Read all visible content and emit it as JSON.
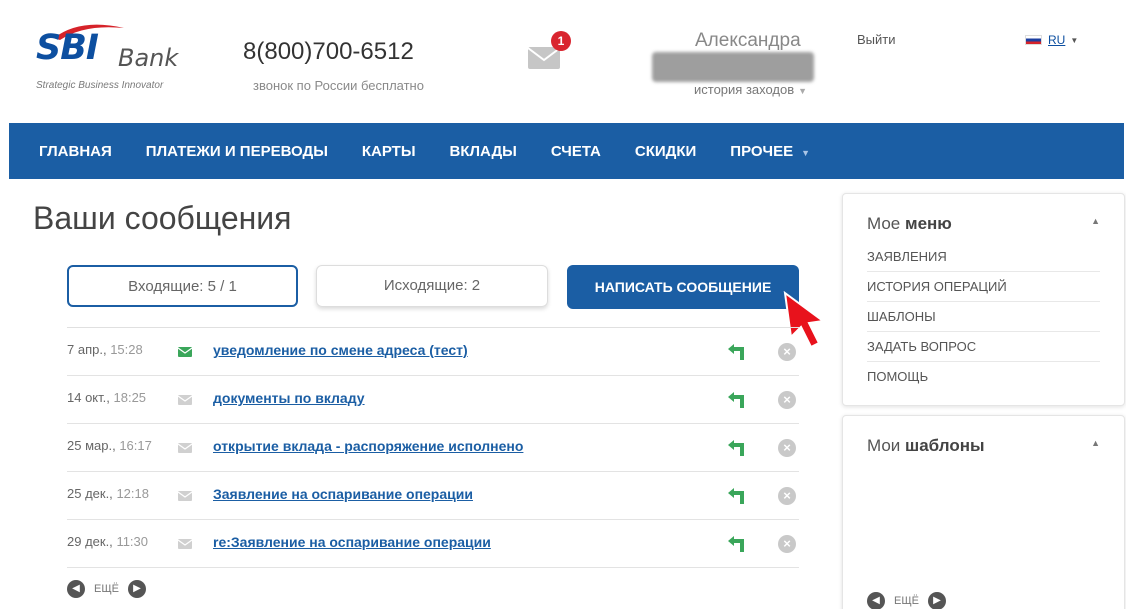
{
  "brand": {
    "logo_main": "SBI",
    "logo_sub": "Bank",
    "tagline": "Strategic Business Innovator"
  },
  "header": {
    "phone": "8(800)700-6512",
    "phone_note": "звонок по России бесплатно",
    "mail_badge": "1",
    "user_name": "Александра",
    "history_label": "история заходов",
    "logout_label": "Выйти",
    "language": "RU"
  },
  "nav": {
    "items": [
      {
        "label": "ГЛАВНАЯ"
      },
      {
        "label": "ПЛАТЕЖИ И ПЕРЕВОДЫ"
      },
      {
        "label": "КАРТЫ"
      },
      {
        "label": "ВКЛАДЫ"
      },
      {
        "label": "СЧЕТА"
      },
      {
        "label": "СКИДКИ"
      },
      {
        "label": "ПРОЧЕЕ"
      }
    ]
  },
  "main": {
    "title": "Ваши сообщения",
    "tabs": {
      "inbox": "Входящие: 5 / 1",
      "outbox": "Исходящие: 2"
    },
    "write_button": "НАПИСАТЬ СООБЩЕНИЕ",
    "messages": [
      {
        "date": "7 апр.,",
        "time": "15:28",
        "subject": "уведомление по смене адреса (тест)",
        "unread": true
      },
      {
        "date": "14 окт.,",
        "time": "18:25",
        "subject": "документы по вкладу",
        "unread": false
      },
      {
        "date": "25 мар.,",
        "time": "16:17",
        "subject": "открытие вклада - распоряжение исполнено",
        "unread": false
      },
      {
        "date": "25 дек.,",
        "time": "12:18",
        "subject": "Заявление на оспаривание операции",
        "unread": false
      },
      {
        "date": "29 дек.,",
        "time": "11:30",
        "subject": "re:Заявление на оспаривание операции",
        "unread": false
      }
    ],
    "more_label": "ЕЩЁ"
  },
  "sidebar": {
    "menu": {
      "title_light": "Мое",
      "title_bold": "меню",
      "items": [
        {
          "label": "ЗАЯВЛЕНИЯ"
        },
        {
          "label": "ИСТОРИЯ ОПЕРАЦИЙ"
        },
        {
          "label": "ШАБЛОНЫ"
        },
        {
          "label": "ЗАДАТЬ ВОПРОС"
        },
        {
          "label": "ПОМОЩЬ"
        }
      ]
    },
    "templates": {
      "title_light": "Мои",
      "title_bold": "шаблоны",
      "more_label": "ЕЩЁ"
    }
  },
  "colors": {
    "primary": "#1b5ea4",
    "badge": "#d9252f",
    "unread_envelope": "#3aa65a",
    "reply_icon": "#3aa65a"
  }
}
